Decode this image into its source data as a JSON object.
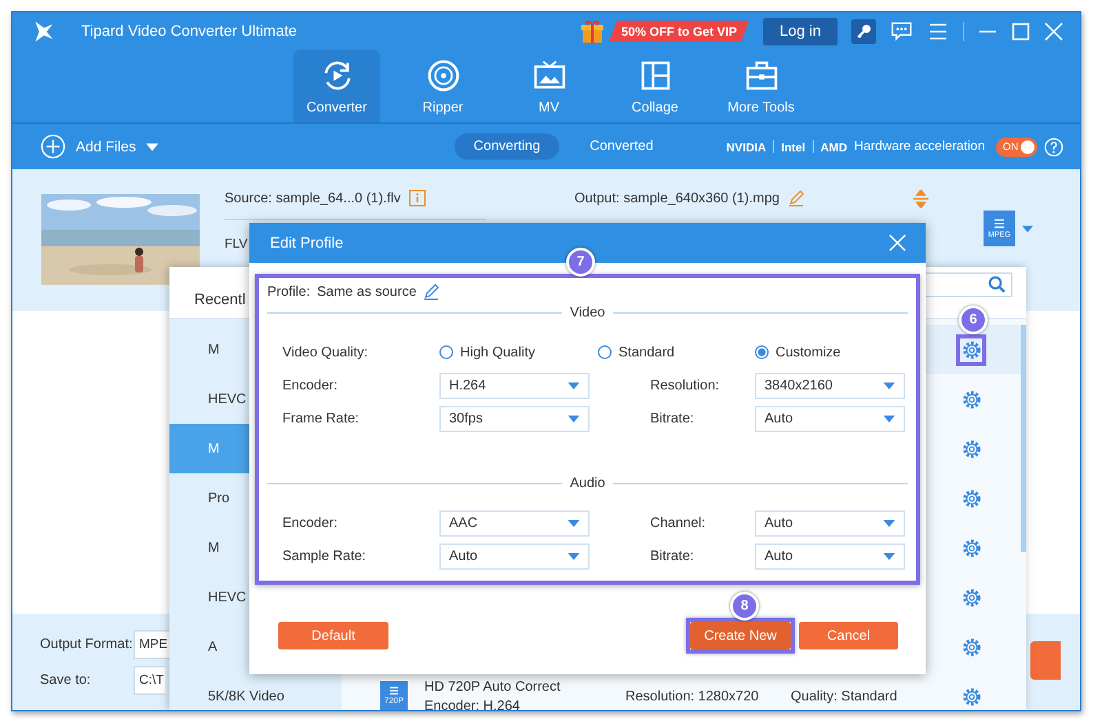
{
  "window": {
    "title": "Tipard Video Converter Ultimate",
    "promo": "50% OFF to Get VIP",
    "login": "Log in"
  },
  "nav_tabs": [
    {
      "label": "Converter",
      "selected": true
    },
    {
      "label": "Ripper",
      "selected": false
    },
    {
      "label": "MV",
      "selected": false
    },
    {
      "label": "Collage",
      "selected": false
    },
    {
      "label": "More Tools",
      "selected": false
    }
  ],
  "toolbar": {
    "add_files": "Add Files",
    "view_tabs": [
      {
        "label": "Converting",
        "selected": true
      },
      {
        "label": "Converted",
        "selected": false
      }
    ],
    "gpu_vendors": [
      "NVIDIA",
      "Intel",
      "AMD"
    ],
    "hardware_acceleration": {
      "label": "Hardware acceleration",
      "toggle": "ON",
      "on": true
    }
  },
  "file": {
    "source": "Source: sample_64...0 (1).flv",
    "format": "FLV",
    "output": "Output: sample_640x360 (1).mpg",
    "output_badge": "MPEG"
  },
  "bottom_bar": {
    "output_format_label": "Output Format:",
    "output_format_value": "MPE",
    "save_to_label": "Save to:",
    "save_to_value": "C:\\T"
  },
  "format_panel": {
    "tab": "Recentl",
    "categories": [
      {
        "label": "M",
        "selected": false
      },
      {
        "label": "HEVC",
        "selected": false
      },
      {
        "label": "M",
        "selected": true
      },
      {
        "label": "Pro",
        "selected": false
      },
      {
        "label": "M",
        "selected": false
      },
      {
        "label": "HEVC",
        "selected": false
      },
      {
        "label": "A",
        "selected": false
      },
      {
        "label": "5K/8K Video",
        "selected": false
      }
    ],
    "presets": [
      {
        "selected": true,
        "step": "6"
      },
      {
        "selected": false
      },
      {
        "selected": false
      },
      {
        "selected": false
      },
      {
        "selected": false
      },
      {
        "selected": false
      },
      {
        "selected": false
      },
      {
        "selected": false,
        "badge": "720P",
        "name": "HD 720P Auto Correct",
        "encoder": "Encoder: H.264",
        "resolution": "Resolution: 1280x720",
        "quality": "Quality: Standard"
      }
    ]
  },
  "edit_profile": {
    "title": "Edit Profile",
    "step": "7",
    "profile_label": "Profile:",
    "profile_value": "Same as source",
    "sections": [
      {
        "title": "Video",
        "rows": [
          {
            "kind": "radio",
            "label": "Video Quality:",
            "options": [
              {
                "label": "High Quality",
                "selected": false
              },
              {
                "label": "Standard",
                "selected": false
              },
              {
                "label": "Customize",
                "selected": true
              }
            ]
          },
          {
            "kind": "selects",
            "fields": [
              {
                "label": "Encoder:",
                "value": "H.264"
              },
              {
                "label": "Resolution:",
                "value": "3840x2160"
              }
            ]
          },
          {
            "kind": "selects",
            "fields": [
              {
                "label": "Frame Rate:",
                "value": "30fps"
              },
              {
                "label": "Bitrate:",
                "value": "Auto"
              }
            ]
          }
        ]
      },
      {
        "title": "Audio",
        "rows": [
          {
            "kind": "selects",
            "fields": [
              {
                "label": "Encoder:",
                "value": "AAC"
              },
              {
                "label": "Channel:",
                "value": "Auto"
              }
            ]
          },
          {
            "kind": "selects",
            "fields": [
              {
                "label": "Sample Rate:",
                "value": "Auto"
              },
              {
                "label": "Bitrate:",
                "value": "Auto"
              }
            ]
          }
        ]
      }
    ],
    "buttons": [
      {
        "label": "Default",
        "kind": "default"
      },
      {
        "label": "Create New",
        "kind": "create",
        "step": "8"
      },
      {
        "label": "Cancel",
        "kind": "cancel"
      }
    ]
  }
}
